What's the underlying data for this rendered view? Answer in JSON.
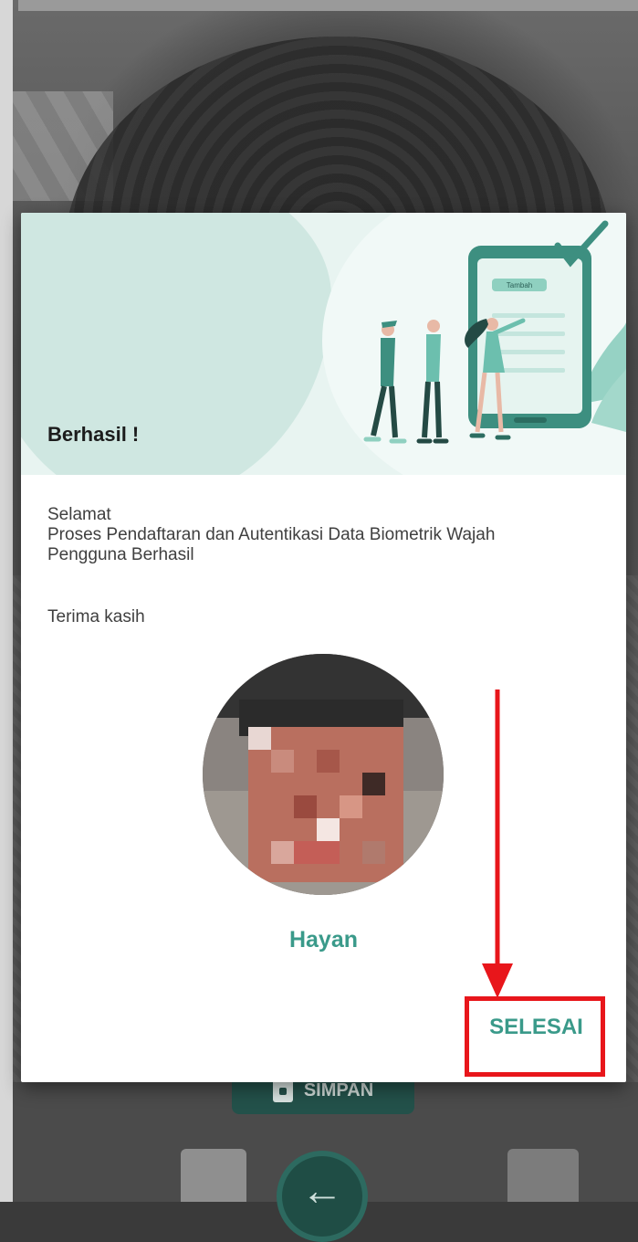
{
  "dialog": {
    "title": "Berhasil !",
    "message_lines": "Selamat\nProses Pendaftaran dan Autentikasi Data Biometrik Wajah\nPengguna Berhasil",
    "thanks": "Terima kasih",
    "user_name": "Hayan",
    "done_label": "SELESAI",
    "illustration_button_text": "Tambah"
  },
  "background": {
    "save_label": "SIMPAN"
  },
  "colors": {
    "accent": "#3a9a8a",
    "annotation": "#e8161b",
    "banner_bg": "#e8f4f1"
  }
}
